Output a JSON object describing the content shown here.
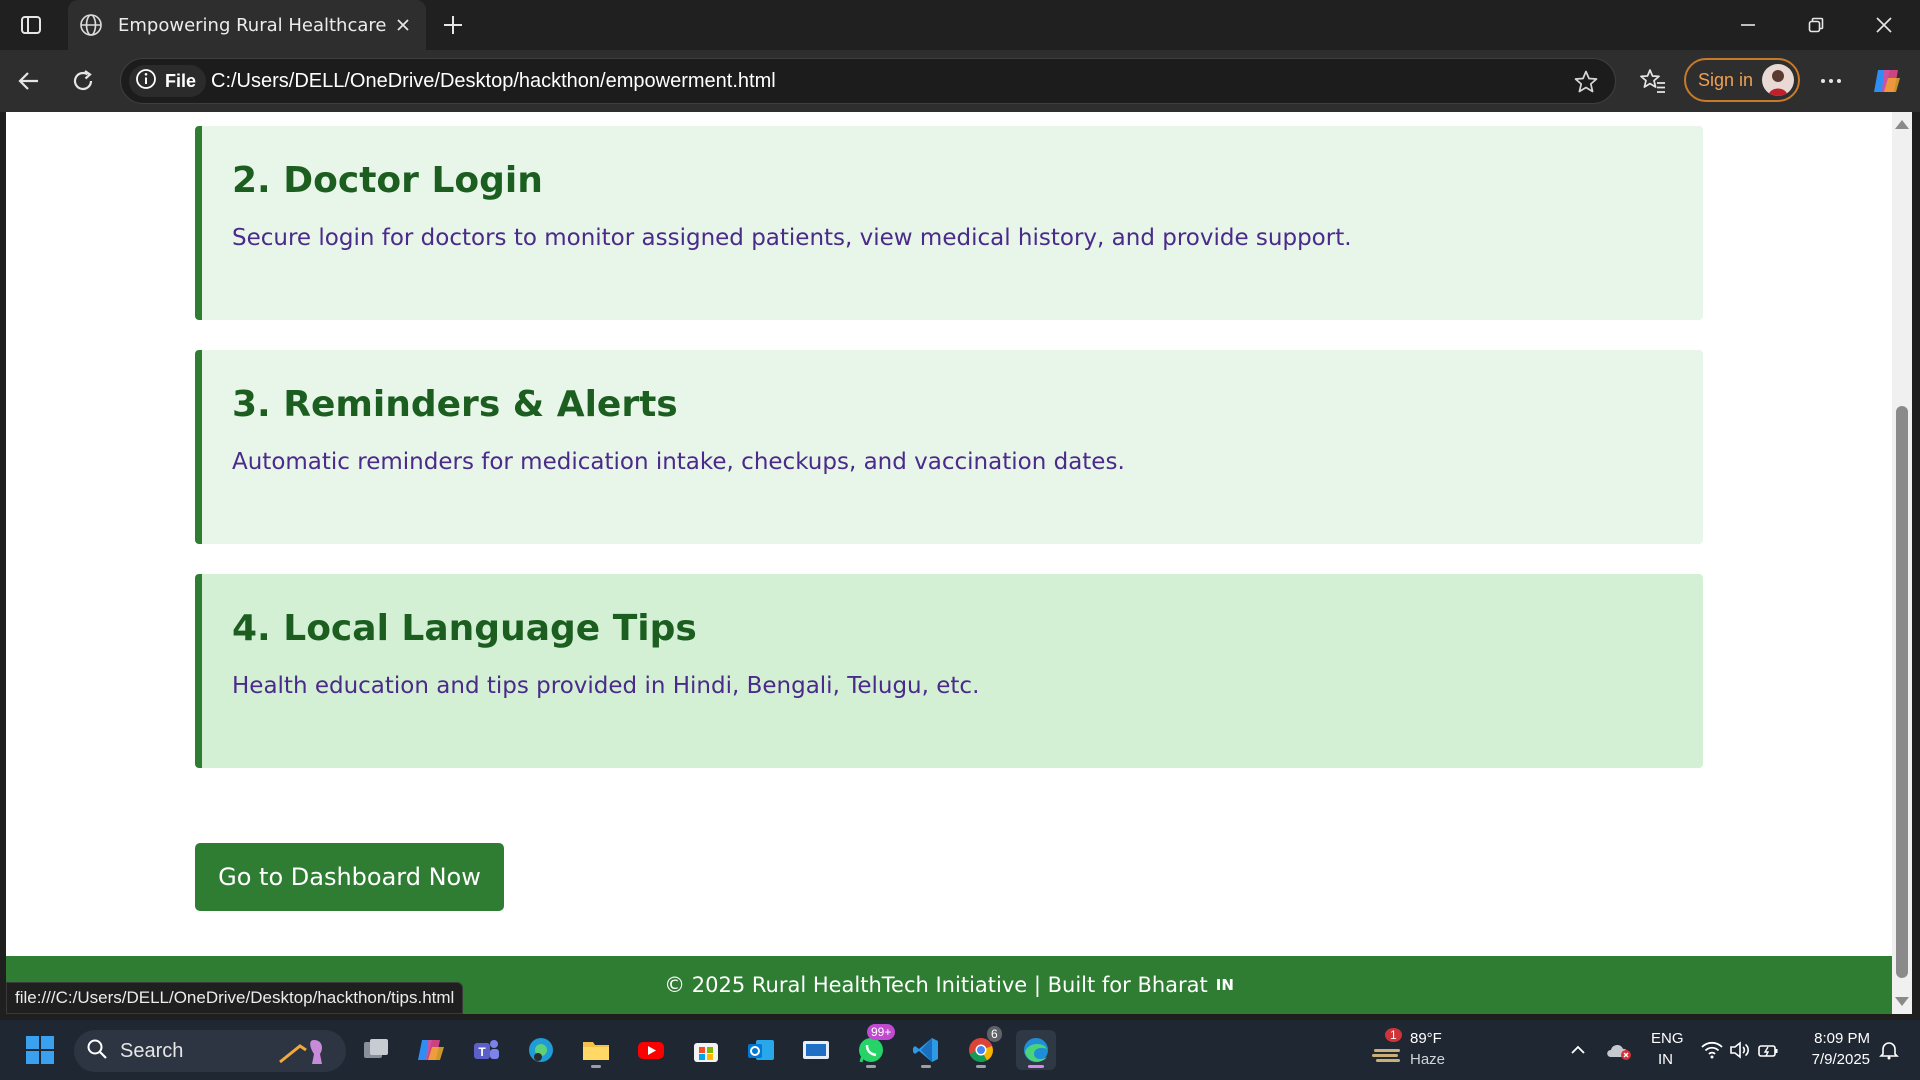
{
  "browser": {
    "tab_title": "Empowering Rural Healthcare",
    "address_chip": "File",
    "url": "C:/Users/DELL/OneDrive/Desktop/hackthon/empowerment.html",
    "sign_in_label": "Sign in",
    "status_url": "file:///C:/Users/DELL/OneDrive/Desktop/hackthon/tips.html"
  },
  "page": {
    "cards": [
      {
        "title": "2. Doctor Login",
        "text": "Secure login for doctors to monitor assigned patients, view medical history, and provide support.",
        "bg": "#e8f5e9"
      },
      {
        "title": "3. Reminders & Alerts",
        "text": "Automatic reminders for medication intake, checkups, and vaccination dates.",
        "bg": "#e8f5e9"
      },
      {
        "title": "4. Local Language Tips",
        "text": "Health education and tips provided in Hindi, Bengali, Telugu, etc.",
        "bg": "#d4f0d4"
      }
    ],
    "dashboard_button": "Go to Dashboard Now",
    "footer_text": "© 2025 Rural HealthTech Initiative | Built for Bharat",
    "footer_flag": "IN",
    "accent_color": "#2e7d32",
    "heading_color": "#1b5e20",
    "body_text_color": "#4a2a8a"
  },
  "taskbar": {
    "search_label": "Search",
    "weather_badge": "1",
    "weather_temp": "89°F",
    "weather_desc": "Haze",
    "whatsapp_badge": "99+",
    "chrome_badge": "6",
    "lang_top": "ENG",
    "lang_bottom": "IN",
    "time": "8:09 PM",
    "date": "7/9/2025",
    "icons": [
      "start-icon",
      "search-icon",
      "task-view-icon",
      "copilot-icon",
      "teams-icon",
      "edge-dev-icon",
      "file-explorer-icon",
      "youtube-icon",
      "store-icon",
      "outlook-icon",
      "app-icon",
      "whatsapp-icon",
      "vscode-icon",
      "chrome-icon",
      "edge-icon"
    ]
  }
}
